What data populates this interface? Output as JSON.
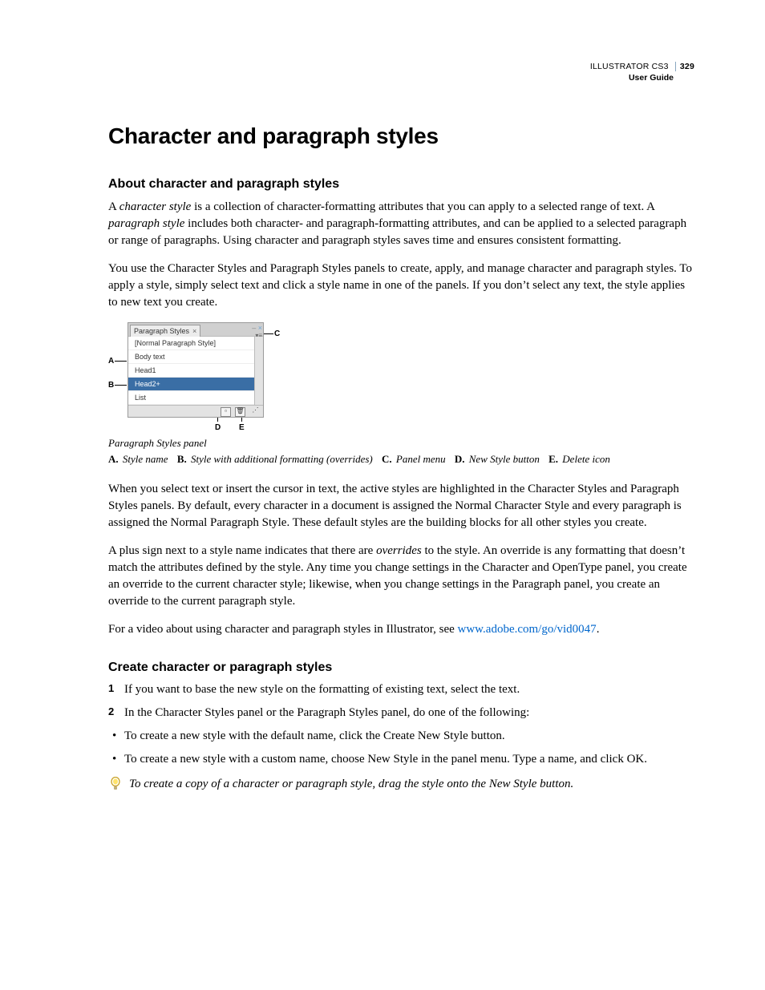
{
  "running_head": {
    "product": "ILLUSTRATOR CS3",
    "page_number": "329",
    "subtitle": "User Guide"
  },
  "h1": "Character and paragraph styles",
  "section1": {
    "heading": "About character and paragraph styles",
    "p1_a": "A ",
    "p1_term1": "character style",
    "p1_b": " is a collection of character-formatting attributes that you can apply to a selected range of text. A ",
    "p1_term2": "paragraph style",
    "p1_c": " includes both character- and paragraph-formatting attributes, and can be applied to a selected paragraph or range of paragraphs. Using character and paragraph styles saves time and ensures consistent formatting.",
    "p2": "You use the Character Styles and Paragraph Styles panels to create, apply, and manage character and paragraph styles. To apply a style, simply select text and click a style name in one of the panels. If you don’t select any text, the style applies to new text you create."
  },
  "figure": {
    "tab_label": "Paragraph Styles",
    "rows": {
      "r0": "[Normal Paragraph Style]",
      "r1": "Body text",
      "r2": "Head1",
      "r3": "Head2+",
      "r4": "List"
    },
    "callouts": {
      "A": "A",
      "B": "B",
      "C": "C",
      "D": "D",
      "E": "E"
    },
    "caption": "Paragraph Styles panel",
    "legend": {
      "A": "Style name",
      "B": "Style with additional formatting (overrides)",
      "C": "Panel menu",
      "D": "New Style button",
      "E": "Delete icon"
    }
  },
  "section1b": {
    "p3": "When you select text or insert the cursor in text, the active styles are highlighted in the Character Styles and Paragraph Styles panels. By default, every character in a document is assigned the Normal Character Style and every paragraph is assigned the Normal Paragraph Style. These default styles are the building blocks for all other styles you create.",
    "p4_a": "A plus sign next to a style name indicates that there are ",
    "p4_term": "overrides",
    "p4_b": " to the style. An override is any formatting that doesn’t match the attributes defined by the style. Any time you change settings in the Character and OpenType panel, you create an override to the current character style; likewise, when you change settings in the Paragraph panel, you create an override to the current paragraph style.",
    "p5_a": "For a video about using character and paragraph styles in Illustrator, see ",
    "p5_link": "www.adobe.com/go/vid0047",
    "p5_b": "."
  },
  "section2": {
    "heading": "Create character or paragraph styles",
    "step1": "If you want to base the new style on the formatting of existing text, select the text.",
    "step2": "In the Character Styles panel or the Paragraph Styles panel, do one of the following:",
    "bullet1": "To create a new style with the default name, click the Create New Style button.",
    "bullet2": "To create a new style with a custom name, choose New Style in the panel menu. Type a name, and click OK.",
    "tip": "To create a copy of a character or paragraph style, drag the style onto the New Style button.",
    "num1": "1",
    "num2": "2"
  }
}
